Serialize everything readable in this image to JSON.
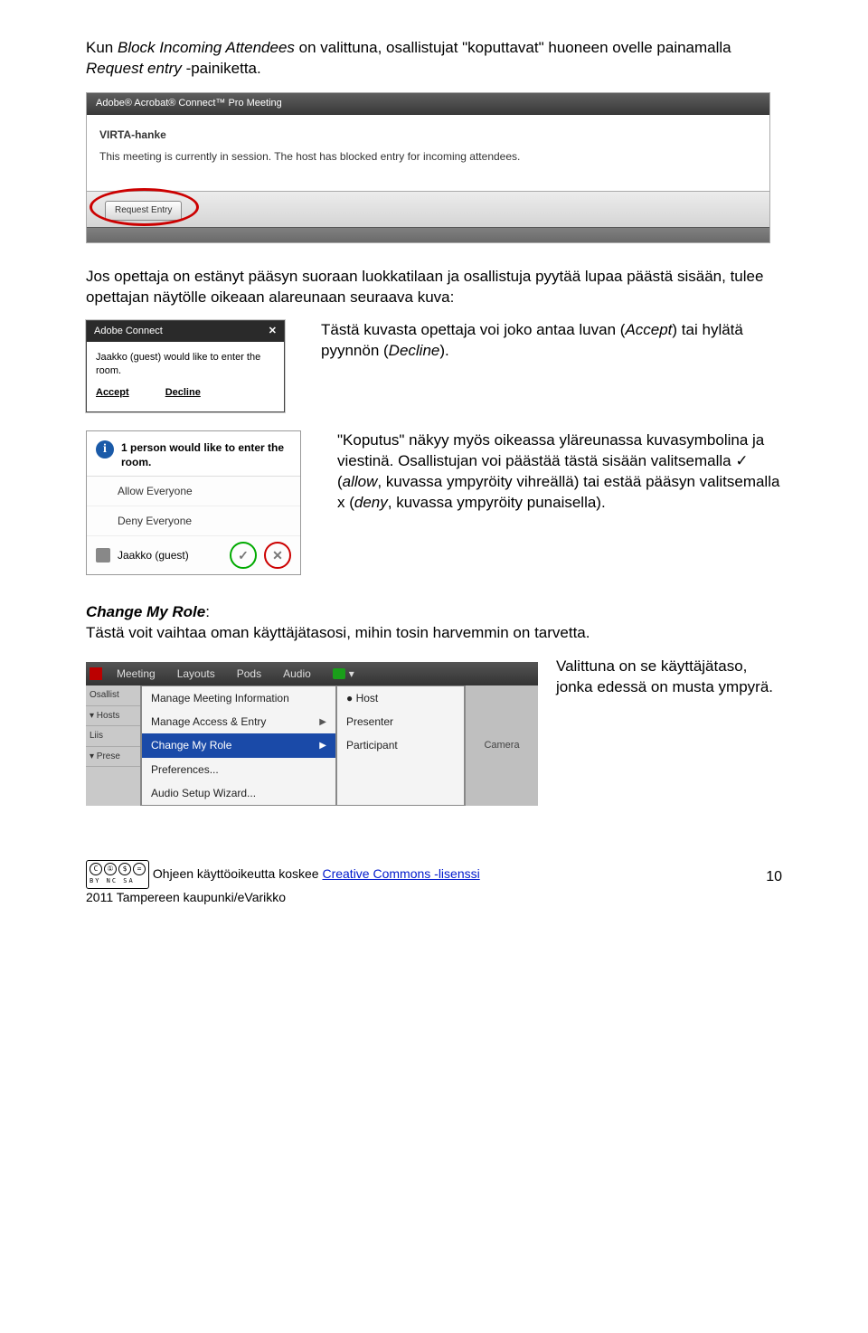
{
  "intro": {
    "line1a": "Kun ",
    "line1b": "Block Incoming Attendees",
    "line1c": " on valittuna, osallistujat \"koputtavat\" huoneen ovelle painamalla ",
    "line1d": "Request entry",
    "line1e": " -painiketta."
  },
  "shot1": {
    "appTitle": "Adobe® Acrobat® Connect™ Pro Meeting",
    "room": "VIRTA-hanke",
    "msg": "This meeting is currently in session. The host has blocked entry for incoming attendees.",
    "button": "Request Entry"
  },
  "para2": "Jos opettaja on estänyt pääsyn suoraan luokkatilaan ja osallistuja pyytää lupaa päästä sisään, tulee opettajan näytölle oikeaan alareunaan seuraava kuva:",
  "shot2": {
    "title": "Adobe Connect",
    "body": "Jaakko (guest) would like to enter the room.",
    "accept": "Accept",
    "decline": "Decline"
  },
  "text2a": "Tästä kuvasta opettaja voi joko antaa luvan (",
  "text2b": "Accept",
  "text2c": ") tai hylätä pyynnön (",
  "text2d": "Decline",
  "text2e": ").",
  "shot3": {
    "head": "1 person would like to enter the room.",
    "allow": "Allow Everyone",
    "deny": "Deny Everyone",
    "guest": "Jaakko (guest)"
  },
  "text3": "\"Koputus\" näkyy myös oikeassa yläreunassa kuvasymbolina ja viestinä. Osallistujan voi päästää tästä sisään valitsemalla ✓ (",
  "text3b": "allow",
  "text3c": ", kuvassa ympyröity vihreällä) tai estää pääsyn valitsemalla x (",
  "text3d": "deny",
  "text3e": ", kuvassa ympyröity punaisella).",
  "changeRole": {
    "title": "Change My Role",
    "text": "Tästä voit vaihtaa oman käyttäjätasosi, mihin tosin harvemmin on tarvetta."
  },
  "shot4": {
    "top": [
      "Meeting",
      "Layouts",
      "Pods",
      "Audio"
    ],
    "left": [
      "Osallist",
      "▾ Hosts",
      "  Liis",
      "▾ Prese"
    ],
    "menu": [
      "Manage Meeting Information",
      "Manage Access & Entry",
      "Change My Role",
      "Preferences...",
      "Audio Setup Wizard..."
    ],
    "sub": [
      "Host",
      "Presenter",
      "Participant"
    ],
    "cam": "Camera"
  },
  "text4": "Valittuna on se käyttäjätaso, jonka edessä on musta ympyrä.",
  "footer": {
    "line1a": "Ohjeen käyttöoikeutta koskee ",
    "line1b": "Creative Commons -lisenssi",
    "line2": "2011 Tampereen kaupunki/eVarikko",
    "page": "10"
  }
}
